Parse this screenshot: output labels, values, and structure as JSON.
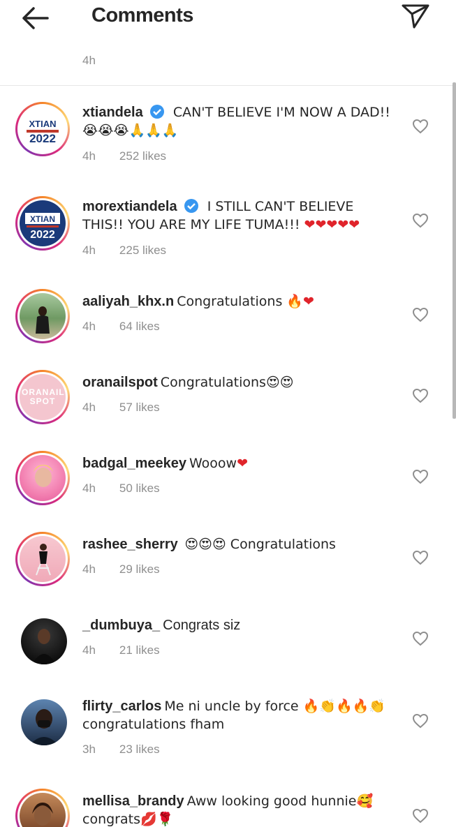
{
  "header": {
    "title": "Comments"
  },
  "top_meta": "4h",
  "comments": [
    {
      "user": "xtiandela",
      "verified": true,
      "text": "CAN'T BELIEVE I'M NOW A DAD!! 😭😭😭🙏🙏🙏",
      "time": "4h",
      "likes": "252 likes",
      "avatar": "xtian-2022-logo"
    },
    {
      "user": "morextiandela",
      "verified": true,
      "text": "I STILL CAN'T BELIEVE THIS!! YOU ARE MY LIFE TUMA!!! ❤❤❤❤❤",
      "time": "4h",
      "likes": "225 likes",
      "avatar": "xtian-2022-logo"
    },
    {
      "user": "aaliyah_khx.n",
      "verified": false,
      "text": "Congratulations 🔥❤",
      "time": "4h",
      "likes": "64 likes",
      "avatar": "photo-outdoor"
    },
    {
      "user": "oranailspot",
      "verified": false,
      "text": "Congratulations😍😍",
      "time": "4h",
      "likes": "57 likes",
      "avatar": "oranailspot-logo",
      "avatar_text": "ORANAIL SPOT"
    },
    {
      "user": "badgal_meekey",
      "verified": false,
      "text": "Wooow❤",
      "time": "4h",
      "likes": "50 likes",
      "avatar": "photo-pink"
    },
    {
      "user": "rashee_sherry",
      "verified": false,
      "text": "😍😍😍 Congratulations",
      "time": "4h",
      "likes": "29 likes",
      "avatar": "photo-chair"
    },
    {
      "user": "_dumbuya_",
      "verified": false,
      "text": "Congrats siz",
      "time": "4h",
      "likes": "21 likes",
      "avatar": "photo-dark"
    },
    {
      "user": "flirty_carlos",
      "verified": false,
      "text": "Me ni uncle by force 🔥👏🔥🔥👏 congratulations fham",
      "time": "3h",
      "likes": "23 likes",
      "avatar": "photo-mask"
    },
    {
      "user": "mellisa_brandy",
      "verified": false,
      "text": "Aww looking good hunnie🥰 congrats💋🌹",
      "time": "",
      "likes": "",
      "avatar": "photo-portrait"
    }
  ],
  "colors": {
    "verified": "#3897f0",
    "meta": "#8e8e8e",
    "text": "#262626"
  }
}
